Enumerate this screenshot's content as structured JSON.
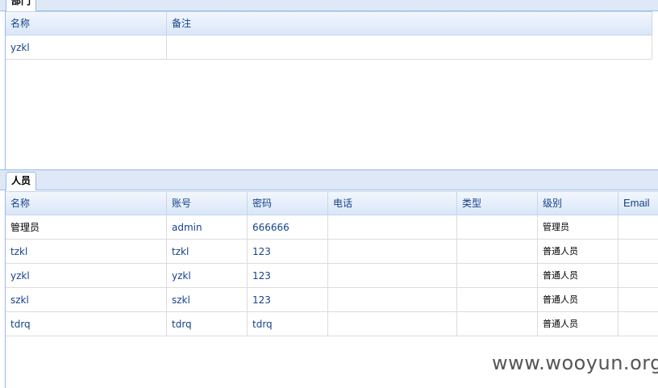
{
  "dept_panel": {
    "tab_label": "部门",
    "columns": [
      "名称",
      "备注"
    ],
    "rows": [
      [
        "yzkl",
        ""
      ]
    ]
  },
  "people_panel": {
    "tab_label": "人员",
    "columns": [
      "名称",
      "账号",
      "密码",
      "电话",
      "类型",
      "级别",
      "Email"
    ],
    "rows": [
      [
        "管理员",
        "admin",
        "666666",
        "",
        "",
        "管理员",
        ""
      ],
      [
        "tzkl",
        "tzkl",
        "123",
        "",
        "",
        "普通人员",
        ""
      ],
      [
        "yzkl",
        "yzkl",
        "123",
        "",
        "",
        "普通人员",
        ""
      ],
      [
        "szkl",
        "szkl",
        "123",
        "",
        "",
        "普通人员",
        ""
      ],
      [
        "tdrq",
        "tdrq",
        "tdrq",
        "",
        "",
        "普通人员",
        ""
      ]
    ]
  },
  "watermark": "www.wooyun.org"
}
